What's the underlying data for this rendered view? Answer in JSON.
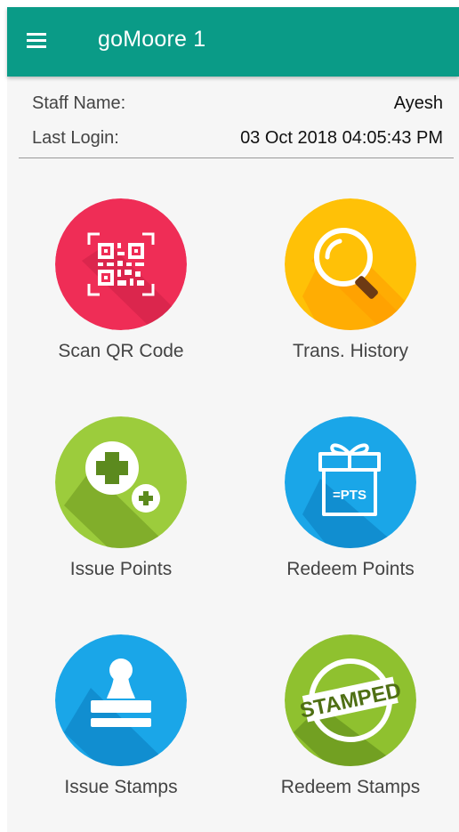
{
  "appbar": {
    "title": "goMoore 1",
    "menu_icon": "hamburger-menu-icon"
  },
  "staff": {
    "name_label": "Staff Name:",
    "name_value": "Ayesh",
    "login_label": "Last Login:",
    "login_value": "03 Oct 2018 04:05:43 PM"
  },
  "tiles": [
    {
      "label": "Scan QR Code",
      "icon": "qr-code-icon",
      "color": "#ef2d56"
    },
    {
      "label": "Trans. History",
      "icon": "magnifier-icon",
      "color": "#ffc107"
    },
    {
      "label": "Issue Points",
      "icon": "plus-icon",
      "color": "#9ccc3c"
    },
    {
      "label": "Redeem Points",
      "icon": "gift-icon",
      "color": "#1aa6e8",
      "icon_text": "=PTS"
    },
    {
      "label": "Issue Stamps",
      "icon": "rubber-stamp-icon",
      "color": "#1aa6e8"
    },
    {
      "label": "Redeem Stamps",
      "icon": "stamped-seal-icon",
      "color": "#8fc12f",
      "icon_text": "STAMPED"
    }
  ]
}
